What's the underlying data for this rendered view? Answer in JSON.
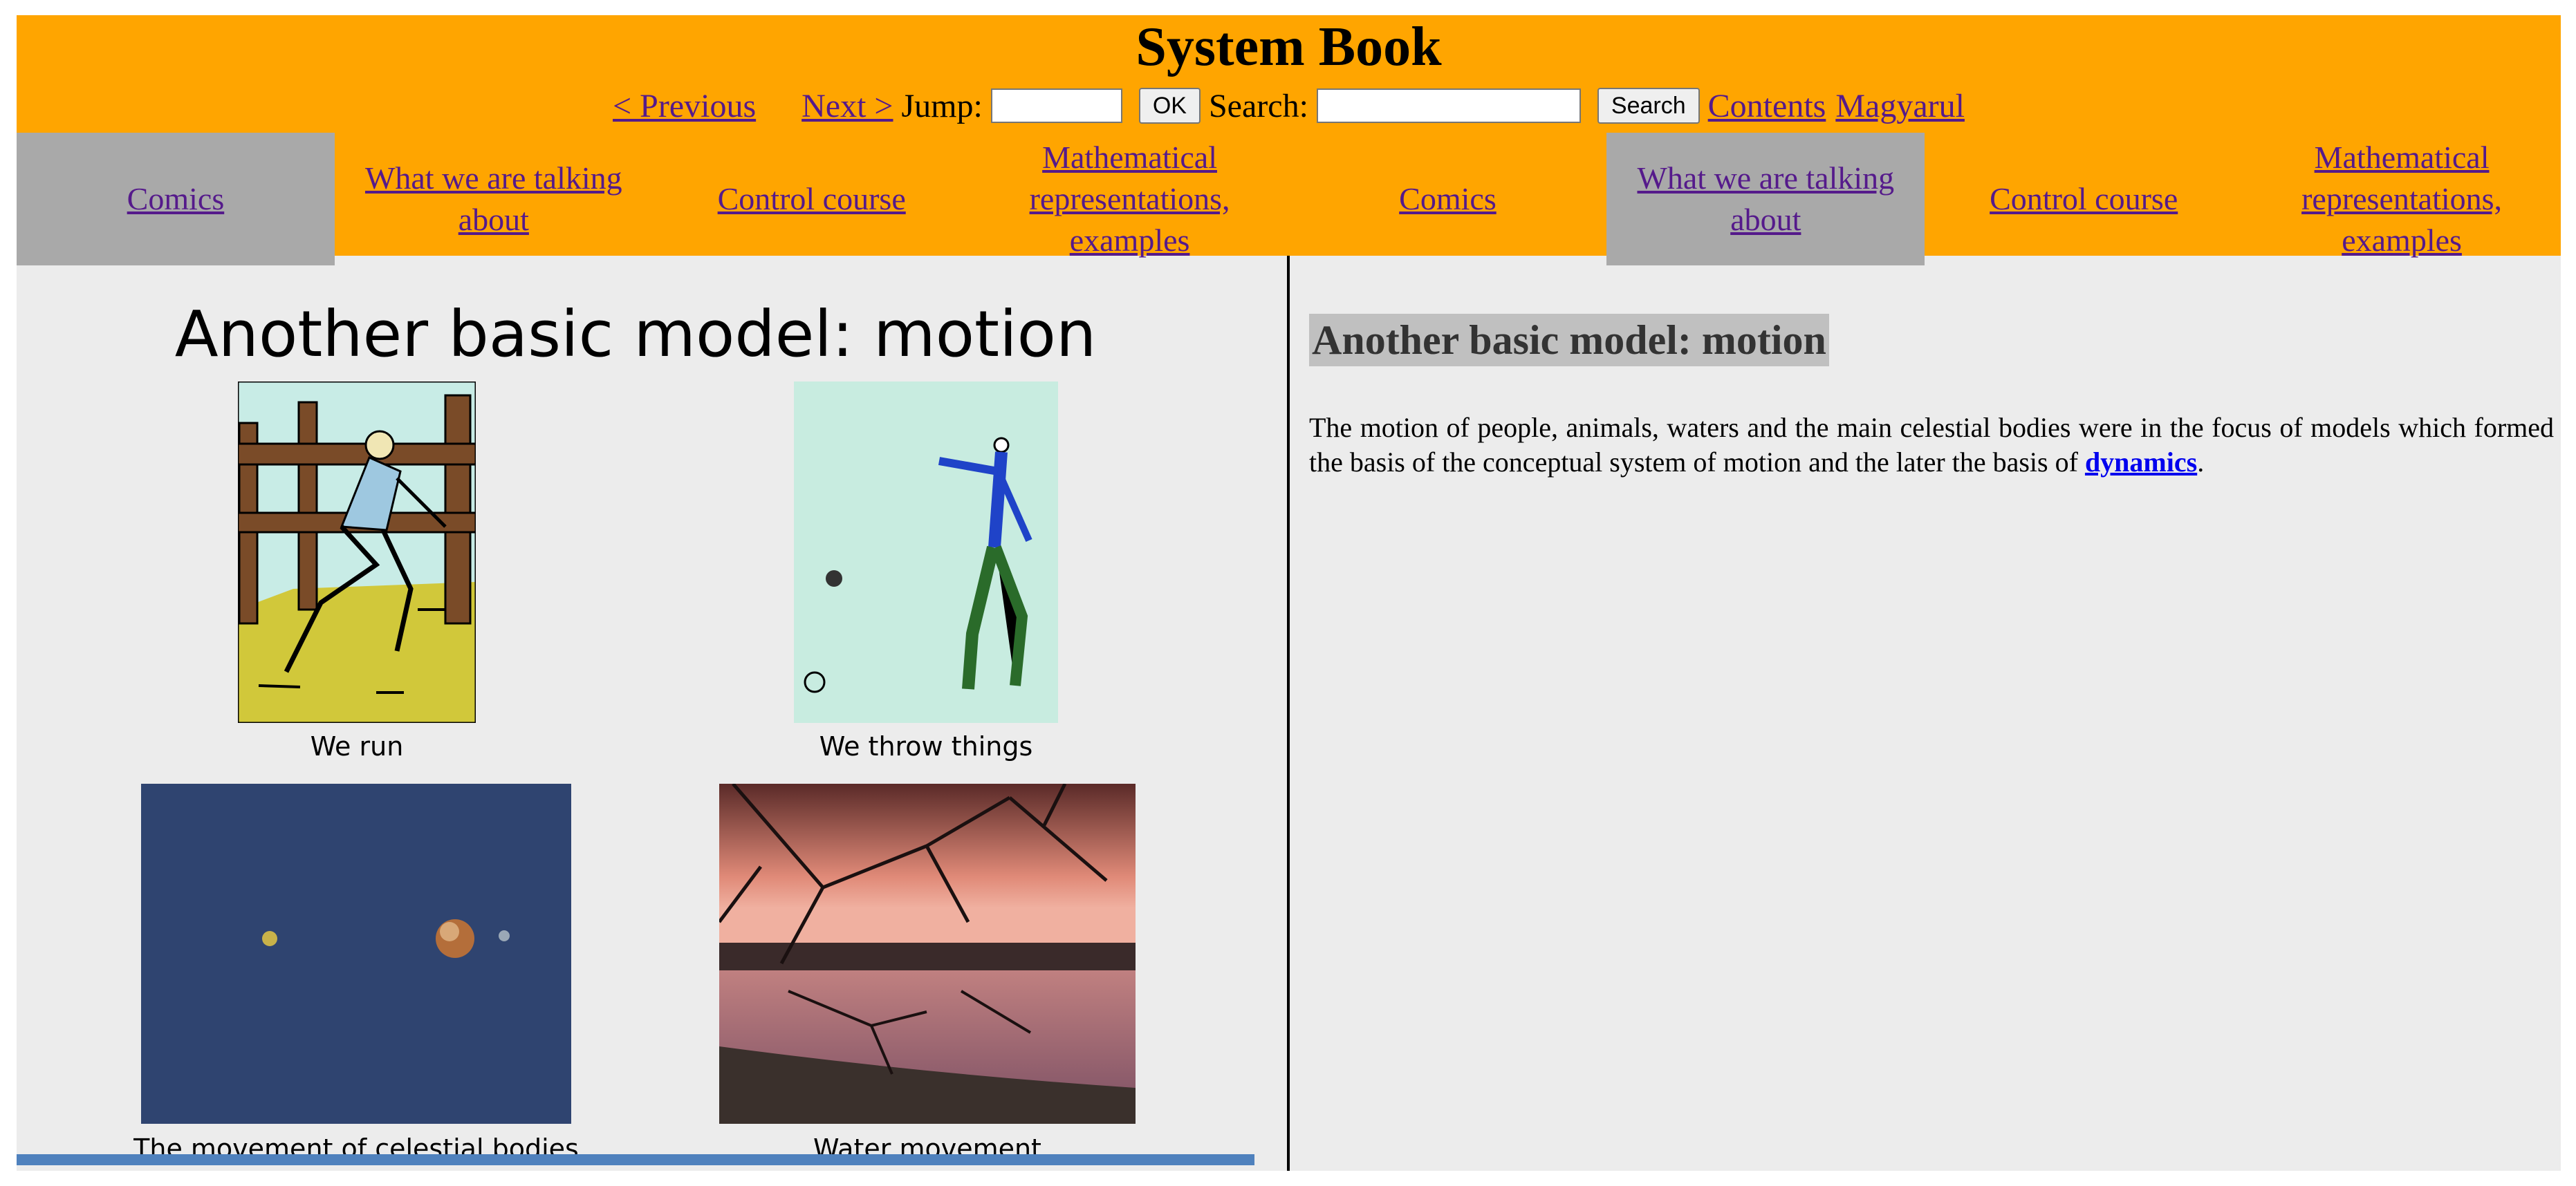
{
  "header": {
    "title": "System Book",
    "nav": {
      "previous": "< Previous",
      "next": "Next >",
      "jump_label": "Jump:",
      "jump_value": "",
      "ok_label": "OK",
      "search_label": "Search:",
      "search_value": "",
      "search_button": "Search",
      "contents": "Contents",
      "language": "Magyarul"
    }
  },
  "tabs_left": [
    {
      "label": "Comics",
      "active": true
    },
    {
      "label": "What we are talking about",
      "active": false
    },
    {
      "label": "Control course",
      "active": false
    },
    {
      "label": "Mathematical representations, examples",
      "active": false
    }
  ],
  "tabs_right": [
    {
      "label": "Comics",
      "active": false
    },
    {
      "label": "What we are talking about",
      "active": true
    },
    {
      "label": "Control course",
      "active": false
    },
    {
      "label": "Mathematical representations, examples",
      "active": false
    }
  ],
  "slide": {
    "title": "Another basic model: motion",
    "captions": {
      "run": "We run",
      "throw": "We throw things",
      "celestial": "The movement of celestial bodies",
      "water": "Water movement"
    }
  },
  "article": {
    "heading": "Another basic model: motion",
    "text_before_link": "The motion of people, animals, waters and the main celestial bodies were in the focus of models which formed the basis of the conceptual system of motion and the later the basis of ",
    "link": "dynamics",
    "text_after_link": "."
  },
  "colors": {
    "header_bg": "#ffa500",
    "active_tab_bg": "#a9a9a9",
    "page_bg": "#ececec",
    "link": "#551a8b",
    "slide_bar": "#4f81bd"
  }
}
